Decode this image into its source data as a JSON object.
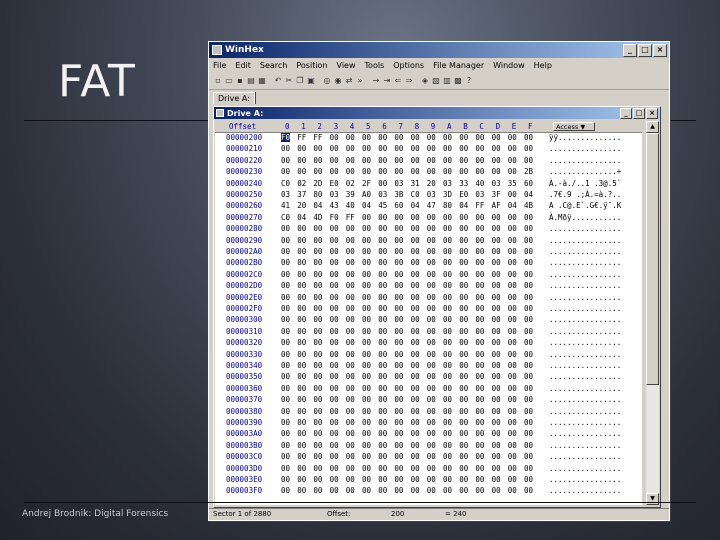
{
  "slide": {
    "title": "FAT",
    "footer": "Andrej Brodnik: Digital Forensics"
  },
  "window": {
    "title": "WinHex",
    "buttons": [
      "_",
      "□",
      "×"
    ],
    "menu": [
      "File",
      "Edit",
      "Search",
      "Position",
      "View",
      "Tools",
      "Options",
      "File Manager",
      "Window",
      "Help"
    ],
    "tab": "Drive A:",
    "child_title": "Drive A:"
  },
  "hex": {
    "offset_label": "Offset",
    "columns": [
      "0",
      "1",
      "2",
      "3",
      "4",
      "5",
      "6",
      "7",
      "8",
      "9",
      "A",
      "B",
      "C",
      "D",
      "E",
      "F"
    ],
    "access_label": "Access ▼",
    "rows": [
      {
        "offset": "00000200",
        "hex": [
          "F0",
          "FF",
          "FF",
          "00",
          "00",
          "00",
          "00",
          "00",
          "00",
          "00",
          "00",
          "00",
          "00",
          "00",
          "00",
          "00"
        ],
        "ascii": "ÿÿ.............."
      },
      {
        "offset": "00000210",
        "hex": [
          "00",
          "00",
          "00",
          "00",
          "00",
          "00",
          "00",
          "00",
          "00",
          "00",
          "00",
          "00",
          "00",
          "00",
          "00",
          "00"
        ],
        "ascii": "................"
      },
      {
        "offset": "00000220",
        "hex": [
          "00",
          "00",
          "00",
          "00",
          "00",
          "00",
          "00",
          "00",
          "00",
          "00",
          "00",
          "00",
          "00",
          "00",
          "00",
          "00"
        ],
        "ascii": "................"
      },
      {
        "offset": "00000230",
        "hex": [
          "00",
          "00",
          "00",
          "00",
          "00",
          "00",
          "00",
          "00",
          "00",
          "00",
          "00",
          "00",
          "00",
          "00",
          "00",
          "2B"
        ],
        "ascii": "...............+"
      },
      {
        "offset": "00000240",
        "hex": [
          "C0",
          "02",
          "2D",
          "E0",
          "02",
          "2F",
          "00",
          "03",
          "31",
          "20",
          "03",
          "33",
          "40",
          "03",
          "35",
          "60"
        ],
        "ascii": "À.-à./..1 .3@.5`"
      },
      {
        "offset": "00000250",
        "hex": [
          "03",
          "37",
          "80",
          "03",
          "39",
          "A0",
          "03",
          "3B",
          "C0",
          "03",
          "3D",
          "E0",
          "03",
          "3F",
          "00",
          "04"
        ],
        "ascii": ".7€.9 .;À.=à.?.."
      },
      {
        "offset": "00000260",
        "hex": [
          "41",
          "20",
          "04",
          "43",
          "40",
          "04",
          "45",
          "60",
          "04",
          "47",
          "80",
          "04",
          "FF",
          "AF",
          "04",
          "4B"
        ],
        "ascii": "A .C@.E`.G€.ÿ¯.K"
      },
      {
        "offset": "00000270",
        "hex": [
          "C0",
          "04",
          "4D",
          "F0",
          "FF",
          "00",
          "00",
          "00",
          "00",
          "00",
          "00",
          "00",
          "00",
          "00",
          "00",
          "00"
        ],
        "ascii": "À.Mðÿ..........."
      },
      {
        "offset": "00000280",
        "hex": [
          "00",
          "00",
          "00",
          "00",
          "00",
          "00",
          "00",
          "00",
          "00",
          "00",
          "00",
          "00",
          "00",
          "00",
          "00",
          "00"
        ],
        "ascii": "................"
      },
      {
        "offset": "00000290",
        "hex": [
          "00",
          "00",
          "00",
          "00",
          "00",
          "00",
          "00",
          "00",
          "00",
          "00",
          "00",
          "00",
          "00",
          "00",
          "00",
          "00"
        ],
        "ascii": "................"
      },
      {
        "offset": "000002A0",
        "hex": [
          "00",
          "00",
          "00",
          "00",
          "00",
          "00",
          "00",
          "00",
          "00",
          "00",
          "00",
          "00",
          "00",
          "00",
          "00",
          "00"
        ],
        "ascii": "................"
      },
      {
        "offset": "000002B0",
        "hex": [
          "00",
          "00",
          "00",
          "00",
          "00",
          "00",
          "00",
          "00",
          "00",
          "00",
          "00",
          "00",
          "00",
          "00",
          "00",
          "00"
        ],
        "ascii": "................"
      },
      {
        "offset": "000002C0",
        "hex": [
          "00",
          "00",
          "00",
          "00",
          "00",
          "00",
          "00",
          "00",
          "00",
          "00",
          "00",
          "00",
          "00",
          "00",
          "00",
          "00"
        ],
        "ascii": "................"
      },
      {
        "offset": "000002D0",
        "hex": [
          "00",
          "00",
          "00",
          "00",
          "00",
          "00",
          "00",
          "00",
          "00",
          "00",
          "00",
          "00",
          "00",
          "00",
          "00",
          "00"
        ],
        "ascii": "................"
      },
      {
        "offset": "000002E0",
        "hex": [
          "00",
          "00",
          "00",
          "00",
          "00",
          "00",
          "00",
          "00",
          "00",
          "00",
          "00",
          "00",
          "00",
          "00",
          "00",
          "00"
        ],
        "ascii": "................"
      },
      {
        "offset": "000002F0",
        "hex": [
          "00",
          "00",
          "00",
          "00",
          "00",
          "00",
          "00",
          "00",
          "00",
          "00",
          "00",
          "00",
          "00",
          "00",
          "00",
          "00"
        ],
        "ascii": "................"
      },
      {
        "offset": "00000300",
        "hex": [
          "00",
          "00",
          "00",
          "00",
          "00",
          "00",
          "00",
          "00",
          "00",
          "00",
          "00",
          "00",
          "00",
          "00",
          "00",
          "00"
        ],
        "ascii": "................"
      },
      {
        "offset": "00000310",
        "hex": [
          "00",
          "00",
          "00",
          "00",
          "00",
          "00",
          "00",
          "00",
          "00",
          "00",
          "00",
          "00",
          "00",
          "00",
          "00",
          "00"
        ],
        "ascii": "................"
      },
      {
        "offset": "00000320",
        "hex": [
          "00",
          "00",
          "00",
          "00",
          "00",
          "00",
          "00",
          "00",
          "00",
          "00",
          "00",
          "00",
          "00",
          "00",
          "00",
          "00"
        ],
        "ascii": "................"
      },
      {
        "offset": "00000330",
        "hex": [
          "00",
          "00",
          "00",
          "00",
          "00",
          "00",
          "00",
          "00",
          "00",
          "00",
          "00",
          "00",
          "00",
          "00",
          "00",
          "00"
        ],
        "ascii": "................"
      },
      {
        "offset": "00000340",
        "hex": [
          "00",
          "00",
          "00",
          "00",
          "00",
          "00",
          "00",
          "00",
          "00",
          "00",
          "00",
          "00",
          "00",
          "00",
          "00",
          "00"
        ],
        "ascii": "................"
      },
      {
        "offset": "00000350",
        "hex": [
          "00",
          "00",
          "00",
          "00",
          "00",
          "00",
          "00",
          "00",
          "00",
          "00",
          "00",
          "00",
          "00",
          "00",
          "00",
          "00"
        ],
        "ascii": "................"
      },
      {
        "offset": "00000360",
        "hex": [
          "00",
          "00",
          "00",
          "00",
          "00",
          "00",
          "00",
          "00",
          "00",
          "00",
          "00",
          "00",
          "00",
          "00",
          "00",
          "00"
        ],
        "ascii": "................"
      },
      {
        "offset": "00000370",
        "hex": [
          "00",
          "00",
          "00",
          "00",
          "00",
          "00",
          "00",
          "00",
          "00",
          "00",
          "00",
          "00",
          "00",
          "00",
          "00",
          "00"
        ],
        "ascii": "................"
      },
      {
        "offset": "00000380",
        "hex": [
          "00",
          "00",
          "00",
          "00",
          "00",
          "00",
          "00",
          "00",
          "00",
          "00",
          "00",
          "00",
          "00",
          "00",
          "00",
          "00"
        ],
        "ascii": "................"
      },
      {
        "offset": "00000390",
        "hex": [
          "00",
          "00",
          "00",
          "00",
          "00",
          "00",
          "00",
          "00",
          "00",
          "00",
          "00",
          "00",
          "00",
          "00",
          "00",
          "00"
        ],
        "ascii": "................"
      },
      {
        "offset": "000003A0",
        "hex": [
          "00",
          "00",
          "00",
          "00",
          "00",
          "00",
          "00",
          "00",
          "00",
          "00",
          "00",
          "00",
          "00",
          "00",
          "00",
          "00"
        ],
        "ascii": "................"
      },
      {
        "offset": "000003B0",
        "hex": [
          "00",
          "00",
          "00",
          "00",
          "00",
          "00",
          "00",
          "00",
          "00",
          "00",
          "00",
          "00",
          "00",
          "00",
          "00",
          "00"
        ],
        "ascii": "................"
      },
      {
        "offset": "000003C0",
        "hex": [
          "00",
          "00",
          "00",
          "00",
          "00",
          "00",
          "00",
          "00",
          "00",
          "00",
          "00",
          "00",
          "00",
          "00",
          "00",
          "00"
        ],
        "ascii": "................"
      },
      {
        "offset": "000003D0",
        "hex": [
          "00",
          "00",
          "00",
          "00",
          "00",
          "00",
          "00",
          "00",
          "00",
          "00",
          "00",
          "00",
          "00",
          "00",
          "00",
          "00"
        ],
        "ascii": "................"
      },
      {
        "offset": "000003E0",
        "hex": [
          "00",
          "00",
          "00",
          "00",
          "00",
          "00",
          "00",
          "00",
          "00",
          "00",
          "00",
          "00",
          "00",
          "00",
          "00",
          "00"
        ],
        "ascii": "................"
      },
      {
        "offset": "000003F0",
        "hex": [
          "00",
          "00",
          "00",
          "00",
          "00",
          "00",
          "00",
          "00",
          "00",
          "00",
          "00",
          "00",
          "00",
          "00",
          "00",
          "00"
        ],
        "ascii": "................"
      }
    ]
  },
  "status": {
    "sector": "Sector 1 of 2880",
    "offset_label": "Offset:",
    "offset_value": "200",
    "equals": "= 240"
  },
  "colors": {
    "titlebar": "#0a246a",
    "offset_text": "#0000a8",
    "selection": "#0a246a"
  },
  "icons": [
    "new-file-icon",
    "open-icon",
    "save-icon",
    "print-icon",
    "properties-icon",
    "undo-icon",
    "cut-icon",
    "copy-icon",
    "paste-icon",
    "search-icon",
    "find-hex-icon",
    "replace-icon",
    "goto-icon",
    "back-icon",
    "forward-icon",
    "disk-icon",
    "calculator-icon",
    "help-icon"
  ]
}
